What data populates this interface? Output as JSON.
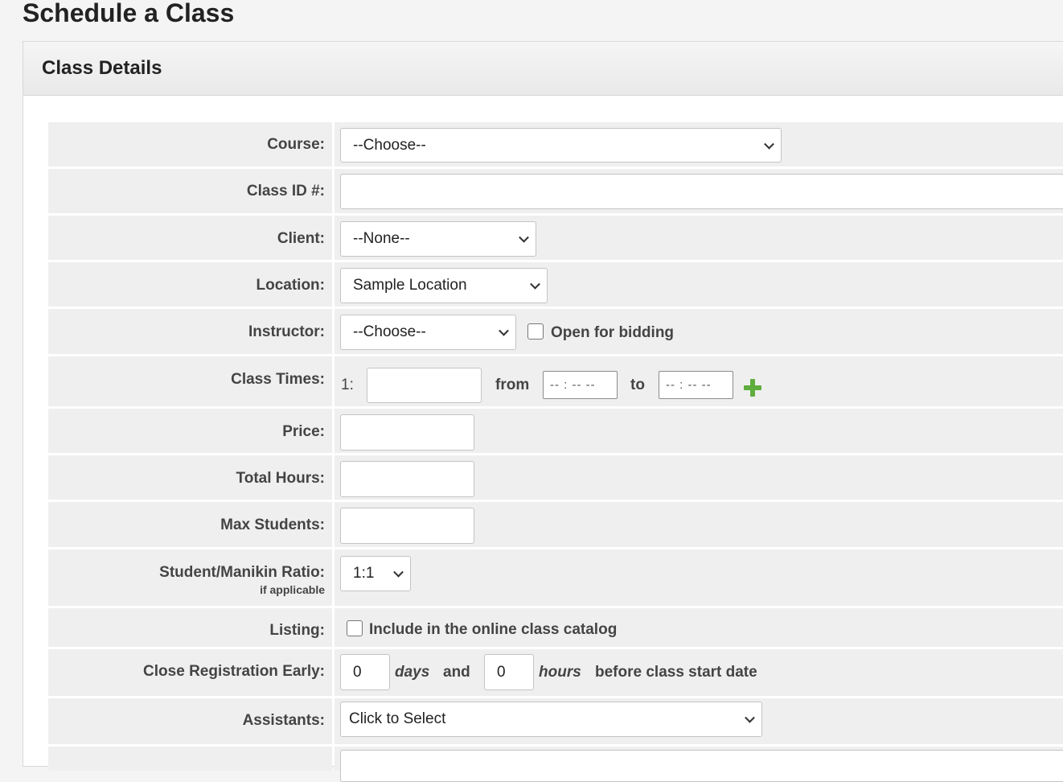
{
  "page": {
    "title": "Schedule a Class"
  },
  "panel": {
    "title": "Class Details"
  },
  "fields": {
    "course": {
      "label": "Course:",
      "value": "--Choose--"
    },
    "class_id": {
      "label": "Class ID #:",
      "value": ""
    },
    "client": {
      "label": "Client:",
      "value": "--None--"
    },
    "location": {
      "label": "Location:",
      "value": "Sample Location"
    },
    "instructor": {
      "label": "Instructor:",
      "value": "--Choose--",
      "bidding_label": "Open for bidding"
    },
    "class_times": {
      "label": "Class Times:",
      "index": "1:",
      "from_label": "from",
      "to_label": "to",
      "from_value": "-- : --  --",
      "to_value": "-- : --  --"
    },
    "price": {
      "label": "Price:",
      "value": ""
    },
    "total_hours": {
      "label": "Total Hours:",
      "value": ""
    },
    "max_students": {
      "label": "Max Students:",
      "value": ""
    },
    "ratio": {
      "label": "Student/Manikin Ratio:",
      "sublabel": "if applicable",
      "value": "1:1"
    },
    "listing": {
      "label": "Listing:",
      "checkbox_label": "Include in the online class catalog"
    },
    "close_registration": {
      "label": "Close Registration Early:",
      "days_value": "0",
      "days_label": "days",
      "and_label": "and",
      "hours_value": "0",
      "hours_label": "hours",
      "suffix": "before class start date"
    },
    "assistants": {
      "label": "Assistants:",
      "value": "Click to Select"
    }
  },
  "icons": {
    "add_time": "plus-icon"
  },
  "colors": {
    "plus_green": "#5fad3c"
  }
}
